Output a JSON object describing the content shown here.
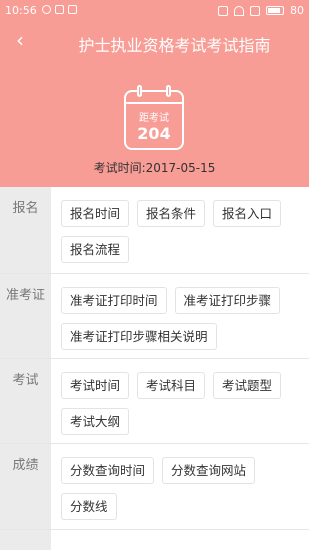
{
  "status_bar": {
    "time": "10:56",
    "battery": "80"
  },
  "header": {
    "title": "护士执业资格考试考试指南",
    "countdown_label": "距考试",
    "countdown_value": "204",
    "exam_date_label": "考试时间:",
    "exam_date": "2017-05-15"
  },
  "sections": [
    {
      "label": "报名",
      "items": [
        "报名时间",
        "报名条件",
        "报名入口",
        "报名流程"
      ]
    },
    {
      "label": "准考证",
      "items": [
        "准考证打印时间",
        "准考证打印步骤",
        "准考证打印步骤相关说明"
      ]
    },
    {
      "label": "考试",
      "items": [
        "考试时间",
        "考试科目",
        "考试题型",
        "考试大纲"
      ]
    },
    {
      "label": "成绩",
      "items": [
        "分数查询时间",
        "分数查询网站",
        "分数线"
      ]
    }
  ],
  "colors": {
    "header": "#f89c96",
    "sidebar": "#ebebeb"
  }
}
